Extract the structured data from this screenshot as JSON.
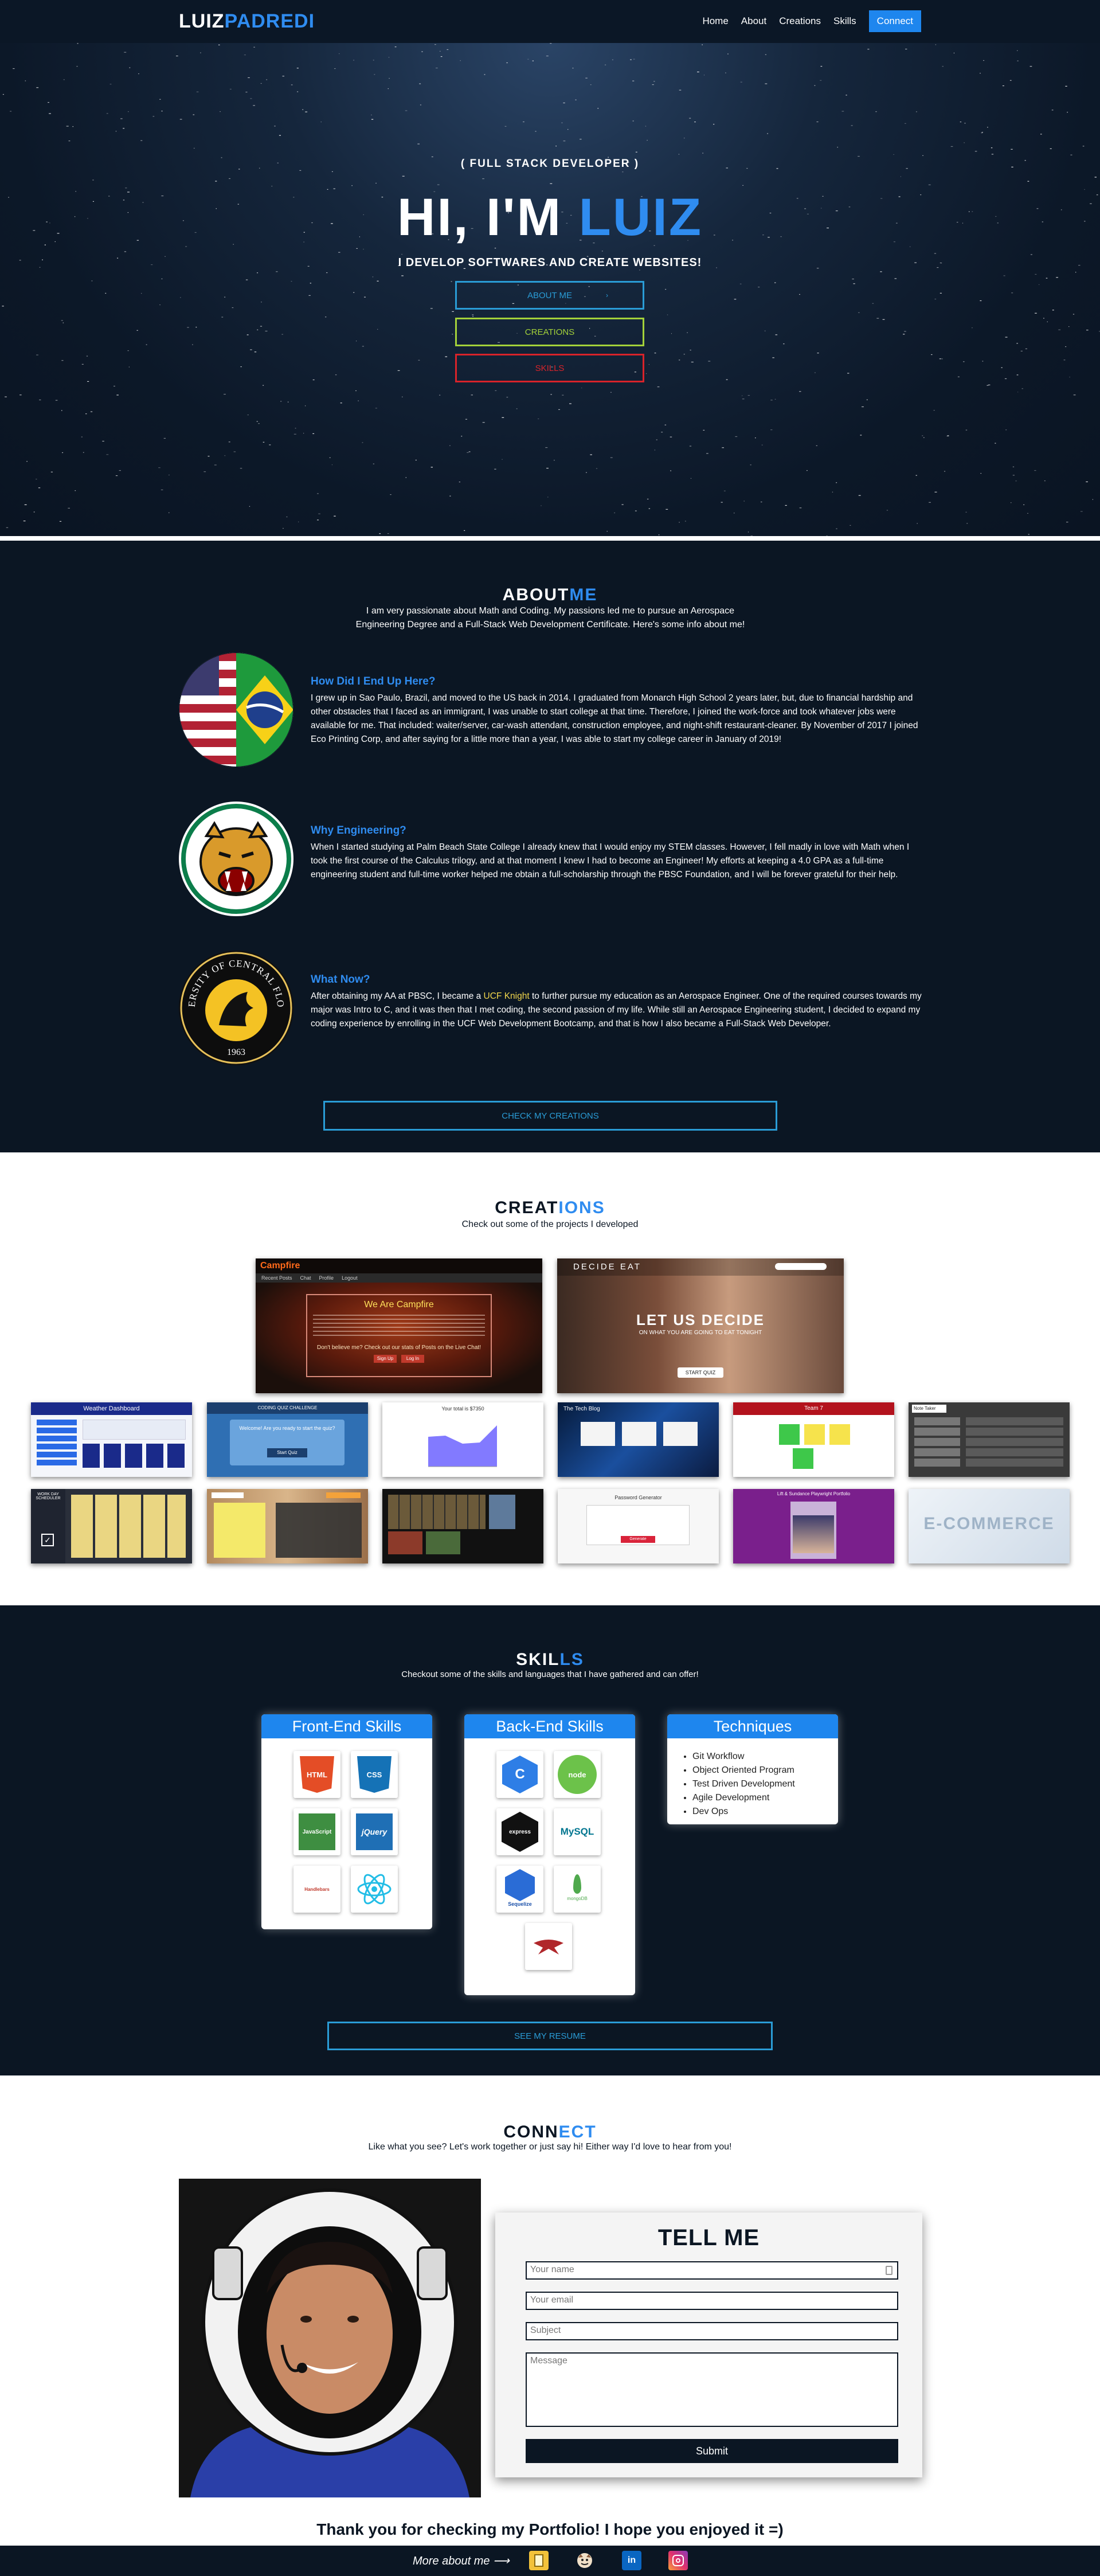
{
  "nav": {
    "brand_first": "LUIZ",
    "brand_second": "PADREDI",
    "links": [
      "Home",
      "About",
      "Creations",
      "Skills"
    ],
    "connect_label": "Connect"
  },
  "hero": {
    "subtitle": "( FULL STACK DEVELOPER )",
    "title_prefix": "HI, I'M ",
    "title_name": "LUIZ",
    "tagline": "I DEVELOP SOFTWARES AND CREATE WEBSITES!",
    "buttons": {
      "about": "ABOUT ME",
      "creations": "CREATIONS",
      "skills": "SKILLS",
      "arrow": "›"
    }
  },
  "about": {
    "title_first": "ABOUT",
    "title_second": "ME",
    "intro": "I am very passionate about Math and Coding. My passions led me to pursue an Aerospace Engineering Degree and a Full-Stack Web Development Certificate. Here's some info about me!",
    "blocks": [
      {
        "heading": "How Did I End Up Here?",
        "text": "I grew up in Sao Paulo, Brazil, and moved to the US back in 2014. I graduated from Monarch High School 2 years later, but, due to financial hardship and other obstacles that I faced as an immigrant, I was unable to start college at that time. Therefore, I joined the work-force and took whatever jobs were available for me. That included: waiter/server, car-wash attendant, construction employee, and night-shift restaurant-cleaner. By November of 2017 I joined Eco Printing Corp, and after saying for a little more than a year, I was able to start my college career in January of 2019!"
      },
      {
        "heading": "Why Engineering?",
        "text": "When I started studying at Palm Beach State College I already knew that I would enjoy my STEM classes. However, I fell madly in love with Math when I took the first course of the Calculus trilogy, and at that moment I knew I had to become an Engineer! My efforts at keeping a 4.0 GPA as a full-time engineering student and full-time worker helped me obtain a full-scholarship through the PBSC Foundation, and I will be forever grateful for their help."
      },
      {
        "heading": "What Now?",
        "text_before": "After obtaining my AA at PBSC, I became a ",
        "text_highlight": "UCF Knight",
        "text_after": " to further pursue my education as an Aerospace Engineer. One of the required courses towards my major was Intro to C, and it was then that I met coding, the second passion of my life. While still an Aerospace Engineering student, I decided to expand my coding experience by enrolling in the UCF Web Development Bootcamp, and that is how I also became a Full-Stack Web Developer."
      }
    ],
    "ucf_text": "UNIVERSITY OF CENTRAL FLORIDA",
    "ucf_year": "1963",
    "button": "CHECK MY CREATIONS"
  },
  "creations": {
    "title_first": "CREAT",
    "title_second": "IONS",
    "subtitle": "Check out some of the projects I developed",
    "projects": {
      "campfire": {
        "logo": "Campfire",
        "heading": "We Are Campfire",
        "cta": "Don't believe me? Check out our stats of Posts on the Live Chat!",
        "btn1": "Sign Up",
        "btn2": "Log In",
        "menu": [
          "Recent Posts",
          "Chat",
          "Profile",
          "Logout"
        ]
      },
      "decide": {
        "logo": "DECIDE EAT",
        "heading": "LET US DECIDE",
        "sub": "ON WHAT YOU ARE GOING TO EAT TONIGHT",
        "btn": "START QUIZ"
      },
      "weather": {
        "title": "Weather Dashboard"
      },
      "quiz": {
        "title": "CODING QUIZ CHALLENGE",
        "question": "Welcome! Are you ready to start the quiz?",
        "btn": "Start Quiz"
      },
      "budget": {
        "title": "Your total is $7350"
      },
      "techblog": {
        "title": "The Tech Blog"
      },
      "team": {
        "title": "Team 7"
      },
      "notetaker": {
        "title": "Note Taker"
      },
      "workday": {
        "title": "WORK DAY SCHEDULER"
      },
      "password": {
        "title": "Password Generator",
        "btn": "Generate"
      },
      "pizza": {
        "title": "Lift & Sundance Playwright Portfolio"
      },
      "ecommerce": {
        "title": "E-COMMERCE"
      }
    }
  },
  "skills": {
    "title_first": "SKIL",
    "title_second": "LS",
    "subtitle": "Checkout some of the skills and languages that I have gathered and can offer!",
    "frontend": {
      "title": "Front-End Skills",
      "icons": [
        "HTML",
        "CSS",
        "JavaScript",
        "jQuery",
        "Handlebars",
        "React"
      ]
    },
    "backend": {
      "title": "Back-End Skills",
      "icons": [
        "C",
        "node",
        "express",
        "MySQL",
        "Sequelize",
        "mongoDB",
        "Heroku"
      ]
    },
    "techniques": {
      "title": "Techniques",
      "items": [
        "Git Workflow",
        "Object Oriented Program",
        "Test Driven Development",
        "Agile Development",
        "Dev Ops"
      ]
    },
    "button": "SEE MY RESUME"
  },
  "connect": {
    "title_first": "CONN",
    "title_second": "ECT",
    "subtitle": "Like what you see? Let's work together or just say hi! Either way I'd love to hear from you!",
    "form": {
      "title": "TELL ME",
      "name_placeholder": "Your name",
      "email_placeholder": "Your email",
      "subject_placeholder": "Subject",
      "message_placeholder": "Message",
      "submit": "Submit"
    },
    "thanks": "Thank you for checking my Portfolio! I hope you enjoyed it =)"
  },
  "footer": {
    "more": "More about me ⟶",
    "icons": [
      "resume-icon",
      "github-icon",
      "linkedin-icon",
      "instagram-icon"
    ],
    "linkedin_text": "in"
  },
  "colors": {
    "brand_blue": "#2f8cf0",
    "navy": "#0b1623",
    "about_btn": "#2a9cd6",
    "creations_btn": "#a3d13a",
    "skills_btn": "#d8232a"
  }
}
